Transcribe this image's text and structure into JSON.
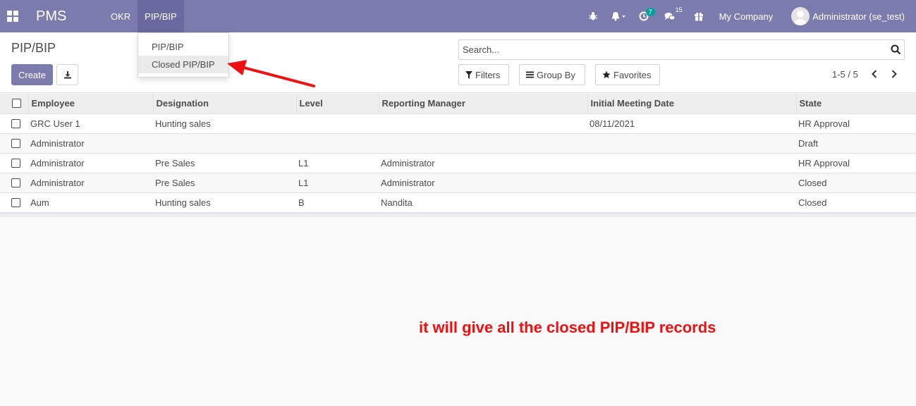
{
  "navbar": {
    "brand": "PMS",
    "menus": [
      "OKR",
      "PIP/BIP"
    ],
    "activity_badge": "7",
    "messages_badge": "15",
    "company": "My Company",
    "user": "Administrator (se_test)",
    "colors": {
      "bar": "#7c7bad",
      "active": "#6a69a0",
      "teal_badge": "#00a09d"
    }
  },
  "dropdown": {
    "items": [
      "PIP/BIP",
      "Closed PIP/BIP"
    ],
    "hovered_item": "Closed PIP/BIP"
  },
  "control_panel": {
    "breadcrumb": "PIP/BIP",
    "create_label": "Create",
    "search_placeholder": "Search...",
    "filters_label": "Filters",
    "group_by_label": "Group By",
    "favorites_label": "Favorites",
    "pager": "1-5 / 5"
  },
  "table": {
    "columns": [
      "Employee",
      "Designation",
      "Level",
      "Reporting Manager",
      "Initial Meeting Date",
      "State"
    ],
    "rows": [
      [
        "GRC User 1",
        "Hunting sales",
        "",
        "",
        "08/11/2021",
        "HR Approval"
      ],
      [
        "Administrator",
        "",
        "",
        "",
        "",
        "Draft"
      ],
      [
        "Administrator",
        "Pre Sales",
        "L1",
        "Administrator",
        "",
        "HR Approval"
      ],
      [
        "Administrator",
        "Pre Sales",
        "L1",
        "Administrator",
        "",
        "Closed"
      ],
      [
        "Aum",
        "Hunting sales",
        "B",
        "Nandita",
        "",
        "Closed"
      ]
    ]
  },
  "annotation": {
    "text": "it will give all the closed PIP/BIP records",
    "color": "#ee1111"
  }
}
